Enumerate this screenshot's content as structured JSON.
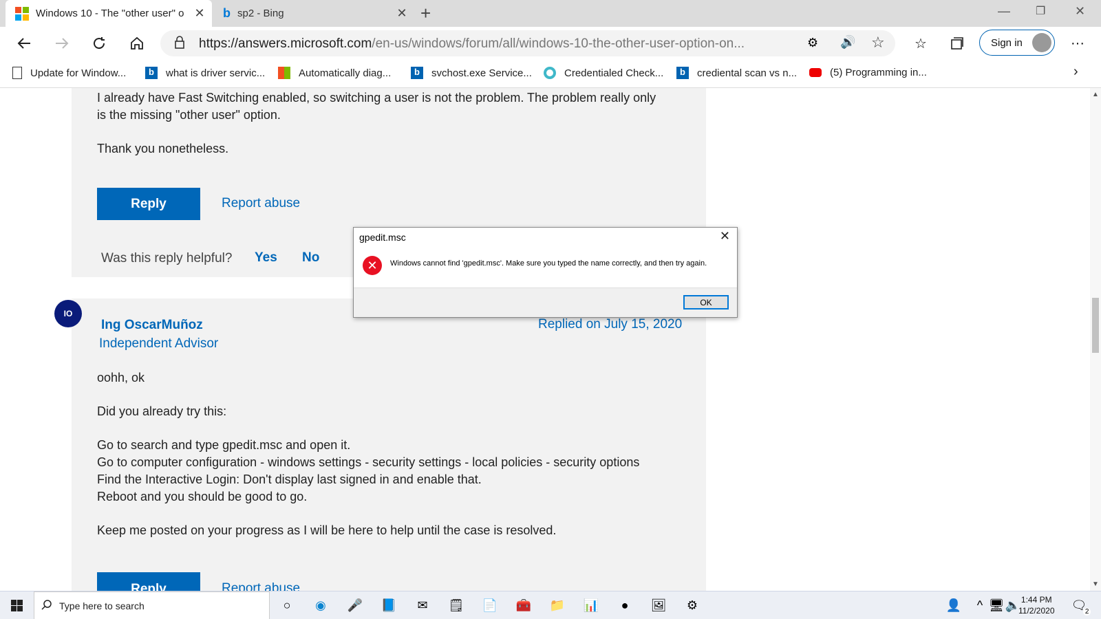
{
  "browser": {
    "tabs": [
      {
        "title": "Windows 10 - The \"other user\" o",
        "active": true
      },
      {
        "title": "sp2 - Bing",
        "active": false
      }
    ],
    "url_host": "https://answers.microsoft.com",
    "url_path": "/en-us/windows/forum/all/windows-10-the-other-user-option-on...",
    "signin_label": "Sign in",
    "favorites": [
      "Update for Window...",
      "what is driver servic...",
      "Automatically diag...",
      "svchost.exe Service...",
      "Credentialed Check...",
      "crediental scan vs n...",
      "(5) Programming in..."
    ]
  },
  "post1": {
    "text_lines": [
      "I already have Fast Switching enabled, so switching a user is not the problem. The problem really only",
      "is the missing \"other user\" option."
    ],
    "thanks": "Thank you nonetheless.",
    "reply_label": "Reply",
    "report_label": "Report abuse",
    "helpful_question": "Was this reply helpful?",
    "yes_label": "Yes",
    "no_label": "No"
  },
  "post2": {
    "avatar_initials": "IO",
    "author": "Ing OscarMuñoz",
    "role": "Independent Advisor",
    "date": "Replied on July 15, 2020",
    "lines": [
      "oohh, ok",
      "Did you already try this:",
      "Go to search and type gpedit.msc and open it.",
      "Go to computer configuration - windows settings - security settings - local policies - security options",
      "Find the Interactive Login: Don't display last signed in and enable that.",
      "Reboot and you should be good to go.",
      "Keep me posted on your progress as I will be here to help until the case is resolved."
    ],
    "reply_label": "Reply",
    "report_label": "Report abuse"
  },
  "dialog": {
    "title": "gpedit.msc",
    "message": "Windows cannot find 'gpedit.msc'. Make sure you typed the name correctly, and then try again.",
    "ok_label": "OK"
  },
  "taskbar": {
    "search_placeholder": "Type here to search",
    "time": "1:44 PM",
    "date": "11/2/2020",
    "notification_count": "2"
  }
}
